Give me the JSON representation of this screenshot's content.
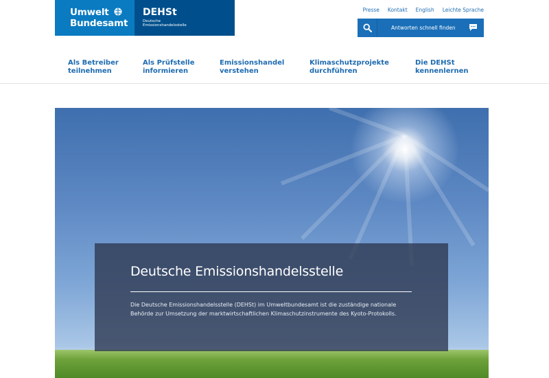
{
  "header": {
    "logo_uba": {
      "line1": "Umwelt",
      "line2": "Bundesamt"
    },
    "logo_dehst": {
      "abbr": "DEHSt",
      "sub1": "Deutsche",
      "sub2": "Emissionshandelsstelle"
    },
    "utility_links": [
      "Presse",
      "Kontakt",
      "English",
      "Leichte Sprache"
    ],
    "search": {
      "label": "Antworten schnell finden"
    }
  },
  "nav": [
    {
      "line1": "Als Betreiber",
      "line2": "teilnehmen"
    },
    {
      "line1": "Als Prüfstelle",
      "line2": "informieren"
    },
    {
      "line1": "Emissionshandel",
      "line2": "verstehen"
    },
    {
      "line1": "Klimaschutzprojekte",
      "line2": "durchführen"
    },
    {
      "line1": "Die DEHSt",
      "line2": "kennenlernen"
    }
  ],
  "hero": {
    "title": "Deutsche Emissionshandelsstelle",
    "description": "Die Deutsche Emissionshandelsstelle (DEHSt) im Umweltbundesamt ist die zuständige nationale Behörde zur Umsetzung der marktwirtschaftlichen Klimaschutzinstrumente des Kyoto-Protokolls."
  },
  "colors": {
    "uba_blue": "#0a7bc1",
    "dehst_blue": "#004f8c",
    "link_blue": "#1e6bb0",
    "search_blue": "#1a6fb8"
  }
}
